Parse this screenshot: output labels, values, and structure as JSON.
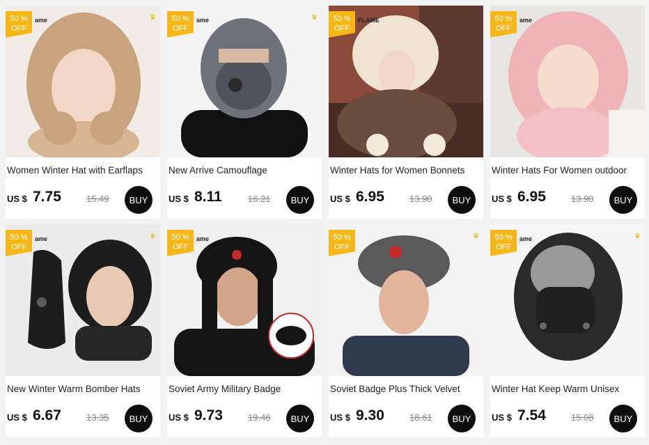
{
  "products": [
    {
      "title": "Women Winter Hat with Earflaps",
      "currency": "US $",
      "price": "7.75",
      "old_price": "15.49",
      "discount_top": "50 %",
      "discount_bottom": "OFF",
      "watermark": "ame",
      "buy_label": "BUY",
      "hat_color": "#c9a27e",
      "bg": "#f1ece6"
    },
    {
      "title": "New Arrive Camouflage",
      "currency": "US $",
      "price": "8.11",
      "old_price": "16.21",
      "discount_top": "50 %",
      "discount_bottom": "OFF",
      "watermark": "ame",
      "buy_label": "BUY",
      "hat_color": "#6e727a",
      "bg": "#f4f4f4"
    },
    {
      "title": "Winter Hats for Women Bonnets",
      "currency": "US $",
      "price": "6.95",
      "old_price": "13.90",
      "discount_top": "50 %",
      "discount_bottom": "OFF",
      "watermark": "FLAME",
      "buy_label": "BUY",
      "hat_color": "#efe3cf",
      "bg": "#8a4a3a"
    },
    {
      "title": "Winter Hats For Women outdoor",
      "currency": "US $",
      "price": "6.95",
      "old_price": "13.90",
      "discount_top": "50 %",
      "discount_bottom": "OFF",
      "watermark": "ame",
      "buy_label": "BUY",
      "hat_color": "#f0b3b8",
      "bg": "#e8e6e2"
    },
    {
      "title": "New Winter Warm Bomber Hats",
      "currency": "US $",
      "price": "6.67",
      "old_price": "13.35",
      "discount_top": "50 %",
      "discount_bottom": "OFF",
      "watermark": "ame",
      "buy_label": "BUY",
      "hat_color": "#1d1d1d",
      "bg": "#ececec"
    },
    {
      "title": "Soviet Army Military Badge",
      "currency": "US $",
      "price": "9.73",
      "old_price": "19.46",
      "discount_top": "50 %",
      "discount_bottom": "OFF",
      "watermark": "ame",
      "buy_label": "BUY",
      "hat_color": "#141414",
      "bg": "#f0f0f0"
    },
    {
      "title": "Soviet Badge Plus Thick Velvet",
      "currency": "US $",
      "price": "9.30",
      "old_price": "18.61",
      "discount_top": "50 %",
      "discount_bottom": "OFF",
      "watermark": "",
      "buy_label": "BUY",
      "hat_color": "#5a5a5a",
      "bg": "#f3f3f3"
    },
    {
      "title": "Winter Hat Keep Warm Unisex",
      "currency": "US $",
      "price": "7.54",
      "old_price": "15.08",
      "discount_top": "50 %",
      "discount_bottom": "OFF",
      "watermark": "ame",
      "buy_label": "BUY",
      "hat_color": "#2a2a2a",
      "bg": "#f5f5f5"
    }
  ]
}
